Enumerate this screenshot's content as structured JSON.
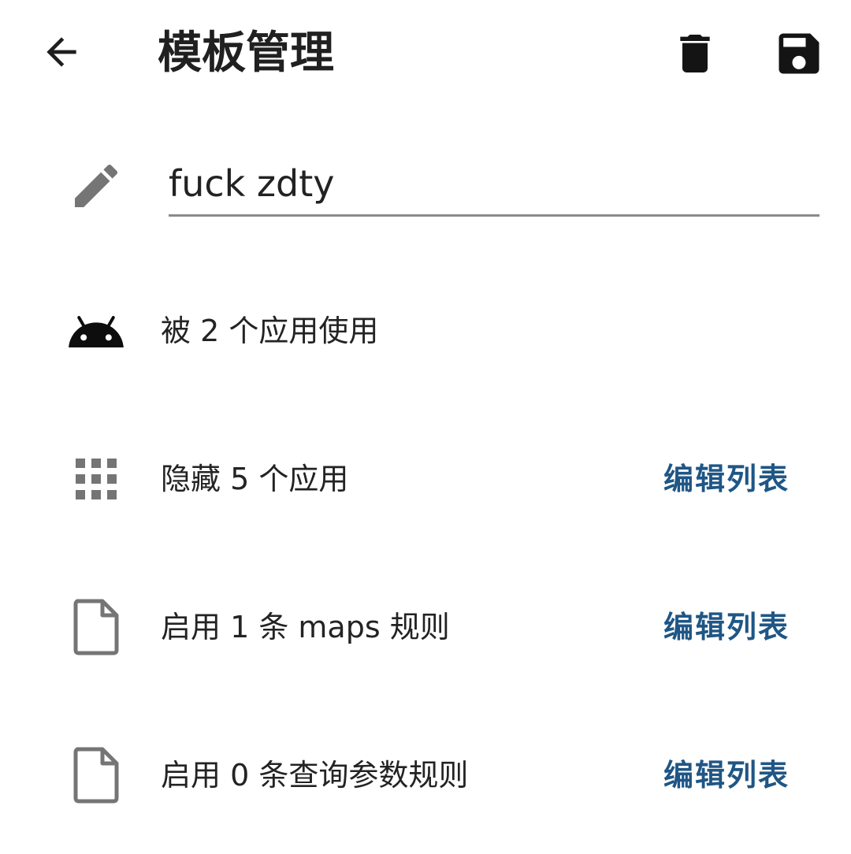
{
  "header": {
    "title": "模板管理",
    "back_icon": "arrow-back-icon",
    "delete_icon": "trash-icon",
    "save_icon": "floppy-disk-icon"
  },
  "name_field": {
    "value": "fuck zdty",
    "icon": "pencil-icon"
  },
  "rows": [
    {
      "icon": "android-icon",
      "text": "被 2 个应用使用",
      "action": ""
    },
    {
      "icon": "app-grid-icon",
      "text": "隐藏 5 个应用",
      "action": "编辑列表"
    },
    {
      "icon": "file-icon",
      "text": "启用 1 条 maps 规则",
      "action": "编辑列表"
    },
    {
      "icon": "file-icon",
      "text": "启用 0 条查询参数规则",
      "action": "编辑列表"
    }
  ],
  "colors": {
    "accent": "#1f5685",
    "icon_gray": "#757575",
    "text": "#232323"
  }
}
